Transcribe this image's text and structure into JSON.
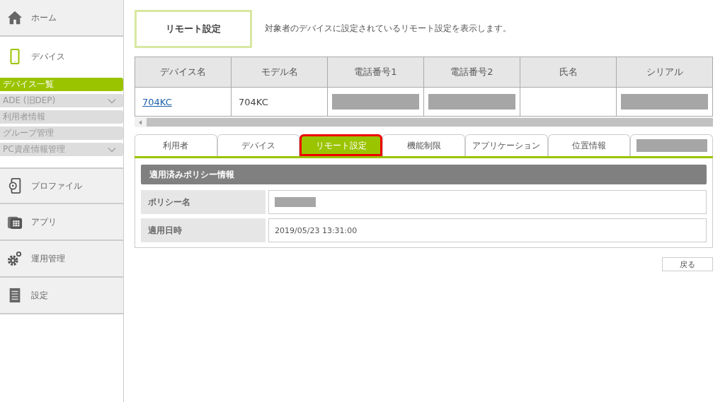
{
  "sidebar": {
    "items": [
      {
        "label": "ホーム",
        "selected": false
      },
      {
        "label": "デバイス",
        "selected": true,
        "children": [
          {
            "label": "デバイス一覧",
            "selected": true,
            "expandable": false
          },
          {
            "label": "ADE (旧DEP)",
            "selected": false,
            "expandable": true
          },
          {
            "label": "利用者情報",
            "selected": false,
            "expandable": false
          },
          {
            "label": "グループ管理",
            "selected": false,
            "expandable": false
          },
          {
            "label": "PC資産情報管理",
            "selected": false,
            "expandable": true
          }
        ]
      },
      {
        "label": "プロファイル",
        "selected": false
      },
      {
        "label": "アプリ",
        "selected": false
      },
      {
        "label": "運用管理",
        "selected": false
      },
      {
        "label": "設定",
        "selected": false
      }
    ]
  },
  "page": {
    "title": "リモート設定",
    "description": "対象者のデバイスに設定されているリモート設定を表示します。"
  },
  "table": {
    "columns": [
      "デバイス名",
      "モデル名",
      "電話番号1",
      "電話番号2",
      "氏名",
      "シリアル"
    ],
    "rows": [
      {
        "cells": [
          {
            "kind": "link",
            "text": "704KC"
          },
          {
            "kind": "text",
            "text": "704KC"
          },
          {
            "kind": "redacted"
          },
          {
            "kind": "redacted"
          },
          {
            "kind": "empty"
          },
          {
            "kind": "redacted"
          }
        ]
      }
    ]
  },
  "tabs": [
    {
      "kind": "text",
      "label": "利用者",
      "selected": false,
      "highlighted": false
    },
    {
      "kind": "text",
      "label": "デバイス",
      "selected": false,
      "highlighted": false
    },
    {
      "kind": "text",
      "label": "リモート設定",
      "selected": true,
      "highlighted": true
    },
    {
      "kind": "text",
      "label": "機能制限",
      "selected": false,
      "highlighted": false
    },
    {
      "kind": "text",
      "label": "アプリケーション",
      "selected": false,
      "highlighted": false
    },
    {
      "kind": "text",
      "label": "位置情報",
      "selected": false,
      "highlighted": false
    },
    {
      "kind": "redacted",
      "selected": false,
      "highlighted": false
    }
  ],
  "section": {
    "title": "適用済みポリシー情報",
    "fields": [
      {
        "label": "ポリシー名",
        "kind": "redacted"
      },
      {
        "label": "適用日時",
        "kind": "text",
        "value": "2019/05/23 13:31:00"
      }
    ]
  },
  "buttons": [
    "戻る"
  ]
}
